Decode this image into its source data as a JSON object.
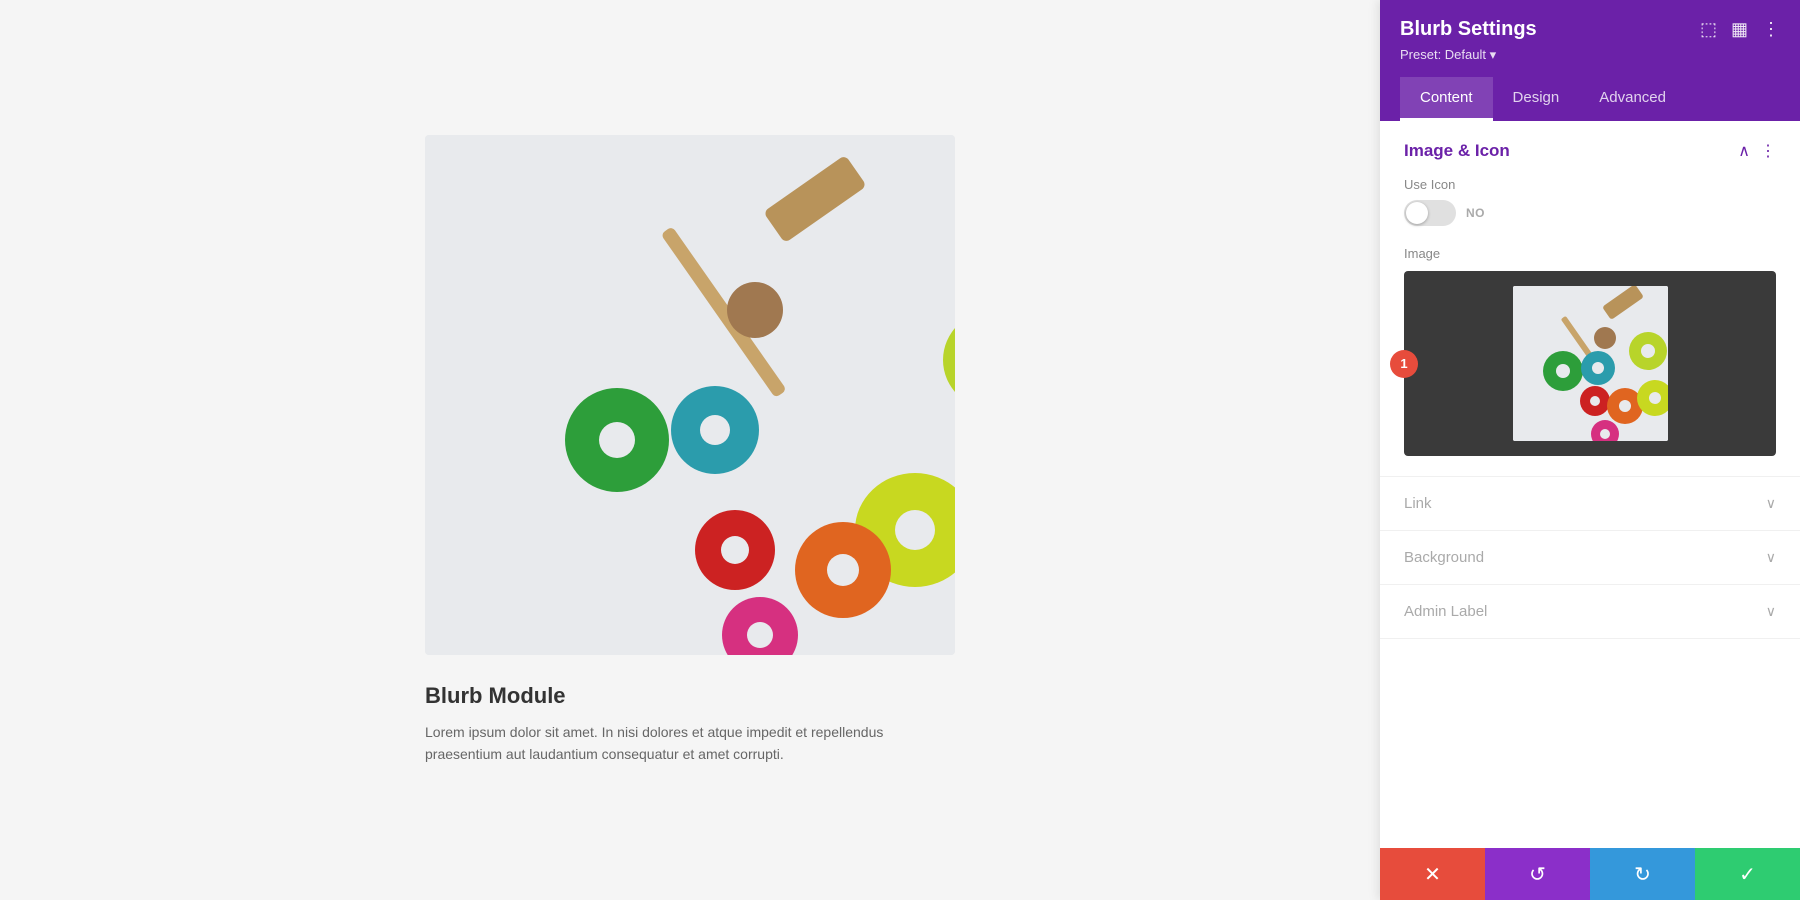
{
  "panel": {
    "title": "Blurb Settings",
    "preset": "Preset: Default ▾",
    "tabs": [
      {
        "id": "content",
        "label": "Content",
        "active": true
      },
      {
        "id": "design",
        "label": "Design",
        "active": false
      },
      {
        "id": "advanced",
        "label": "Advanced",
        "active": false
      }
    ],
    "header_icons": [
      "⬚",
      "▦",
      "⋮"
    ]
  },
  "image_icon_section": {
    "title": "Image & Icon",
    "use_icon_label": "Use Icon",
    "toggle_state": "NO",
    "image_label": "Image",
    "badge": "1"
  },
  "collapsible_sections": [
    {
      "id": "link",
      "label": "Link"
    },
    {
      "id": "background",
      "label": "Background"
    },
    {
      "id": "admin_label",
      "label": "Admin Label"
    }
  ],
  "action_bar": {
    "cancel_icon": "✕",
    "undo_icon": "↺",
    "redo_icon": "↻",
    "save_icon": "✓"
  },
  "preview": {
    "title": "Blurb Module",
    "description": "Lorem ipsum dolor sit amet. In nisi dolores et atque impedit et repellendus praesentium aut laudantium consequatur et amet corrupti."
  }
}
